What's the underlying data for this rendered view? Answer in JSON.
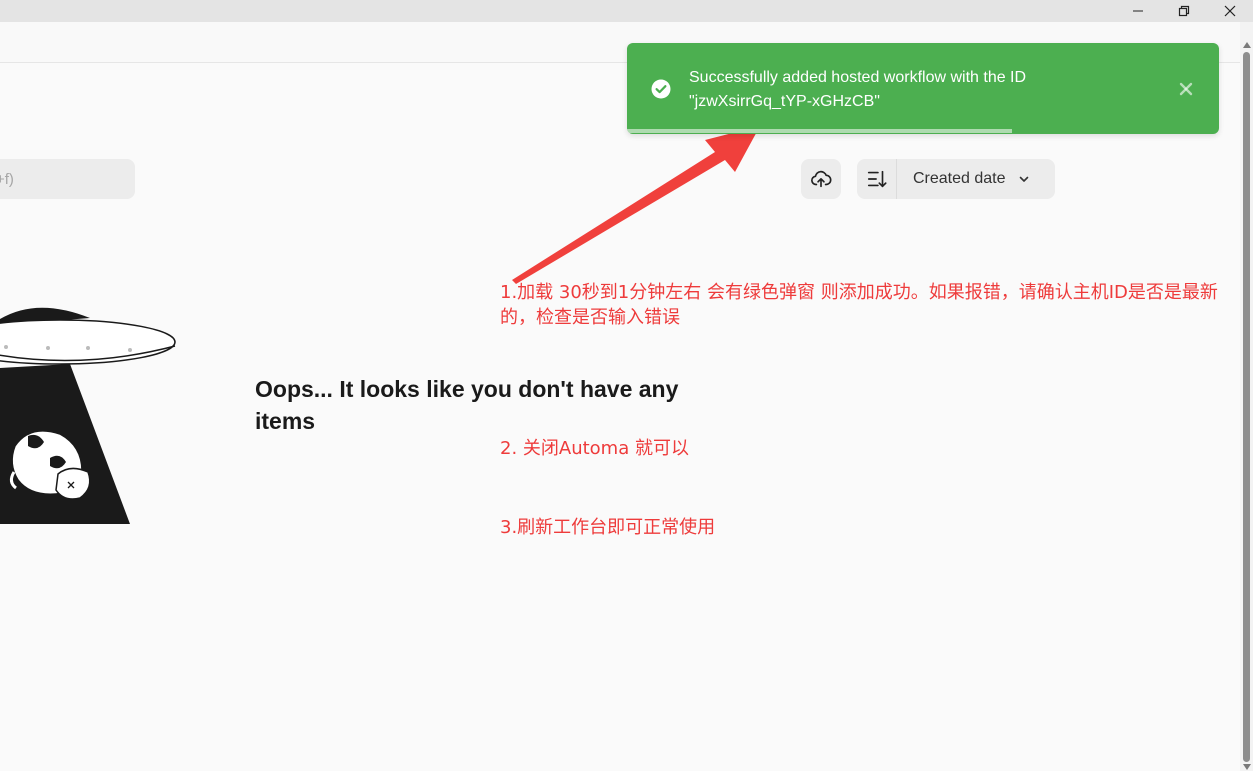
{
  "window": {
    "controls": [
      "minimize",
      "restore",
      "close"
    ]
  },
  "search": {
    "shortcut_hint": "+f)"
  },
  "toolbar": {
    "sort_label": "Created date",
    "cloud_icon": "cloud-upload-icon",
    "sort_icon": "sort-descending-icon"
  },
  "empty_state": {
    "message": "Oops... It looks like you don't have any items"
  },
  "toast": {
    "message": "Successfully added hosted workflow with the ID \"jzwXsirrGq_tYP-xGHzCB\"",
    "color": "#4caf50",
    "progress": 0.65
  },
  "annotations": {
    "color": "#ee3b3b",
    "note_1": "1.加载 30秒到1分钟左右  会有绿色弹窗  则添加成功。如果报错，请确认主机ID是否是最新的，检查是否输入错误",
    "note_2": "2. 关闭Automa 就可以",
    "note_3": "3.刷新工作台即可正常使用"
  }
}
